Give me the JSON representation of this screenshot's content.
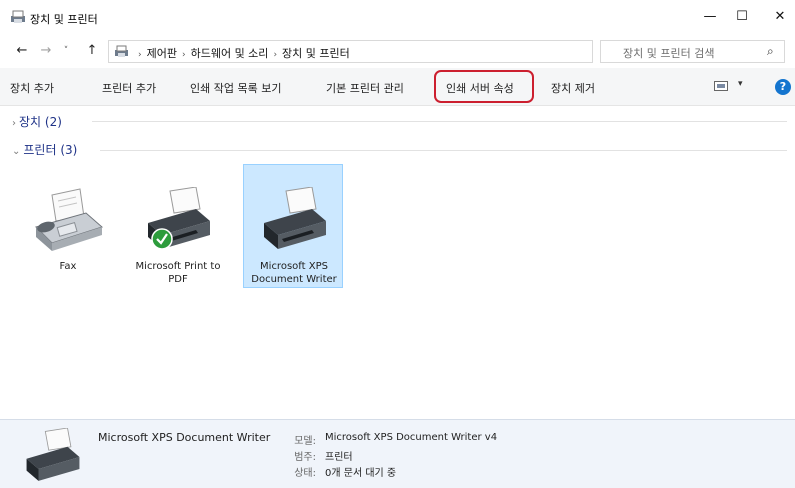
{
  "window": {
    "title": "장치 및 프린터",
    "minimize": "—",
    "maximize": "☐",
    "close": "✕",
    "icon": "devices-printers-icon"
  },
  "address": {
    "back": "←",
    "forward": "→",
    "recent": "˅",
    "up": "↑",
    "breadcrumb": [
      "제어판",
      "하드웨어 및 소리",
      "장치 및 프린터"
    ],
    "dropdown": "˅",
    "refresh": "↻",
    "search_placeholder": "장치 및 프린터 검색",
    "search_icon": "⌕"
  },
  "commands": {
    "add_device": "장치 추가",
    "add_printer": "프린터 추가",
    "print_queue": "인쇄 작업 목록 보기",
    "default_printer": "기본 프린터 관리",
    "server_properties": "인쇄 서버 속성",
    "remove_device": "장치 제거",
    "view_arrow": "▾",
    "help": "?",
    "highlight_color": "#cc1f2f"
  },
  "groups": {
    "devices": {
      "label": "장치 (2)",
      "chevron": "›"
    },
    "printers": {
      "label": "프린터 (3)",
      "chevron": "⌄"
    }
  },
  "printers": [
    {
      "name": "Fax",
      "icon": "fax-icon",
      "selected": false
    },
    {
      "name": "Microsoft Print to PDF",
      "icon": "printer-default-icon",
      "default_badge": "check-icon",
      "selected": false
    },
    {
      "name": "Microsoft XPS Document Writer",
      "icon": "printer-icon",
      "selected": true
    }
  ],
  "details": {
    "name": "Microsoft XPS Document Writer",
    "model_key": "모델:",
    "model_value": "Microsoft XPS Document Writer v4",
    "category_key": "범주:",
    "category_value": "프린터",
    "status_key": "상태:",
    "status_value": "0개 문서 대기 중"
  },
  "colors": {
    "selection_bg": "#cce8ff",
    "group_header": "#1e3287",
    "help_icon": "#1475cf",
    "default_badge": "#2d9c3c"
  }
}
